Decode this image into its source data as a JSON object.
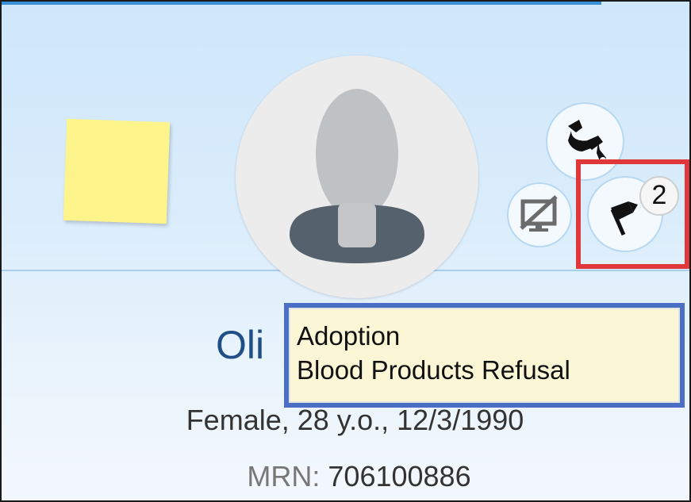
{
  "patient": {
    "name": "Oli",
    "demographics": "Female, 28 y.o., 12/3/1990",
    "mrn_label": "MRN:",
    "mrn_value": "706100886"
  },
  "flags": {
    "count": "2",
    "tooltip_items": [
      "Adoption",
      "Blood Products Refusal"
    ]
  },
  "icons": {
    "sticky_note": "sticky-note-icon",
    "avatar": "avatar-placeholder-icon",
    "nurse": "nurse-call-icon",
    "monitor": "monitor-disabled-icon",
    "flag": "flag-icon"
  },
  "colors": {
    "highlight_red": "#e0383a",
    "highlight_blue": "#4a6fc4",
    "name_blue": "#1f4f86",
    "sticky_yellow": "#fdf58c"
  }
}
